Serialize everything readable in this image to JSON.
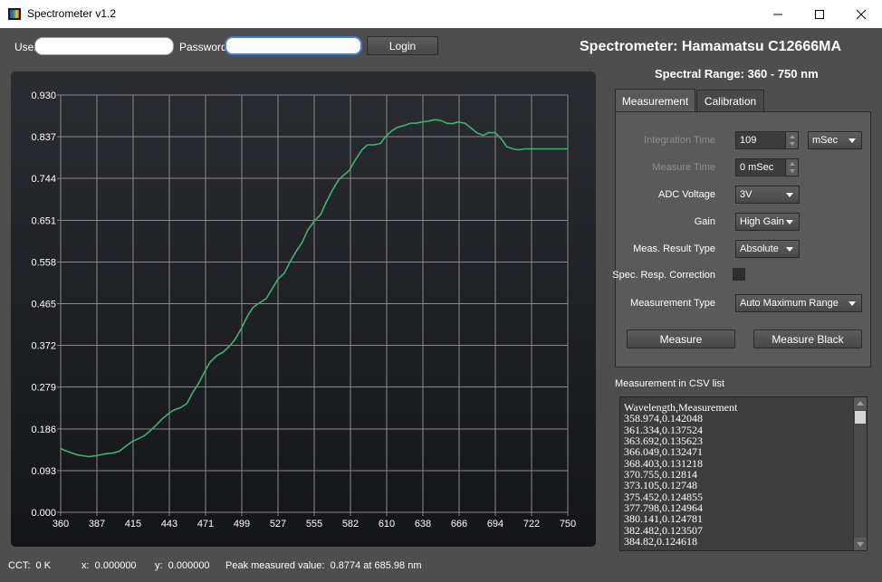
{
  "window": {
    "title": "Spectrometer v1.2"
  },
  "login": {
    "user_label": "User",
    "user_value": "",
    "password_label": "Password",
    "password_value": "",
    "login_button": "Login"
  },
  "header": {
    "title": "Spectrometer: Hamamatsu C12666MA",
    "range": "Spectral Range: 360 - 750 nm"
  },
  "tabs": [
    {
      "label": "Measurement",
      "active": true
    },
    {
      "label": "Calibration",
      "active": false
    }
  ],
  "measurement": {
    "integration_time_label": "Integration Time",
    "integration_time_value": "109",
    "integration_unit": "mSec",
    "measure_time_label": "Measure Time",
    "measure_time_value": "0 mSec",
    "adc_voltage_label": "ADC Voltage",
    "adc_voltage_value": "3V",
    "gain_label": "Gain",
    "gain_value": "High Gain",
    "meas_result_type_label": "Meas. Result Type",
    "meas_result_type_value": "Absolute",
    "spec_resp_correction_label": "Spec. Resp. Correction",
    "spec_resp_correction_checked": false,
    "measurement_type_label": "Measurement Type",
    "measurement_type_value": "Auto Maximum Range",
    "measure_button": "Measure",
    "measure_black_button": "Measure Black"
  },
  "csv": {
    "title": "Measurement in CSV list",
    "lines": [
      "Wavelength,Measurement",
      "358.974,0.142048",
      "361.334,0.137524",
      "363.692,0.135623",
      "366.049,0.132471",
      "368.403,0.131218",
      "370.755,0.12814",
      "373.105,0.12748",
      "375.452,0.124855",
      "377.798,0.124964",
      "380.141,0.124781",
      "382.482,0.123507",
      "384.82,0.124618"
    ]
  },
  "status": {
    "cct": "CCT:  0 K",
    "x": "x:  0.000000",
    "y": "y:  0.000000",
    "peak": "Peak measured value:  0.8774 at 685.98 nm"
  },
  "colors": {
    "line": "#3cb371",
    "grid": "#8a8a8a",
    "axis_text": "#ffffff"
  },
  "chart_data": {
    "type": "line",
    "xlim": [
      360,
      750
    ],
    "ylim": [
      0.0,
      0.93
    ],
    "x_ticks": [
      "360",
      "387",
      "415",
      "443",
      "471",
      "499",
      "527",
      "555",
      "582",
      "610",
      "638",
      "666",
      "694",
      "722",
      "750"
    ],
    "y_ticks": [
      "0.000",
      "0.093",
      "0.186",
      "0.279",
      "0.372",
      "0.465",
      "0.558",
      "0.651",
      "0.744",
      "0.837",
      "0.930"
    ],
    "grid": true,
    "series": [
      {
        "x": [
          360,
          364,
          368,
          373,
          377,
          382,
          387,
          392,
          396,
          400,
          405,
          410,
          415,
          419,
          424,
          429,
          433,
          438,
          443,
          447,
          452,
          457,
          461,
          466,
          471,
          475,
          480,
          485,
          490,
          494,
          499,
          504,
          508,
          513,
          518,
          522,
          527,
          532,
          536,
          541,
          546,
          550,
          555,
          560,
          564,
          569,
          574,
          578,
          582,
          587,
          592,
          596,
          601,
          606,
          610,
          615,
          619,
          624,
          629,
          633,
          638,
          643,
          647,
          652,
          657,
          661,
          666,
          671,
          675,
          680,
          685,
          689,
          694,
          699,
          703,
          708,
          712,
          717,
          722,
          726,
          731,
          736,
          740,
          745,
          750
        ],
        "y": [
          0.142,
          0.137,
          0.133,
          0.128,
          0.126,
          0.124,
          0.126,
          0.129,
          0.131,
          0.132,
          0.136,
          0.147,
          0.158,
          0.163,
          0.17,
          0.182,
          0.193,
          0.208,
          0.22,
          0.228,
          0.233,
          0.242,
          0.264,
          0.287,
          0.315,
          0.335,
          0.349,
          0.357,
          0.371,
          0.385,
          0.41,
          0.439,
          0.457,
          0.467,
          0.476,
          0.495,
          0.519,
          0.533,
          0.556,
          0.581,
          0.603,
          0.629,
          0.649,
          0.664,
          0.69,
          0.718,
          0.742,
          0.752,
          0.762,
          0.787,
          0.809,
          0.819,
          0.819,
          0.822,
          0.838,
          0.851,
          0.858,
          0.862,
          0.867,
          0.867,
          0.87,
          0.872,
          0.875,
          0.874,
          0.867,
          0.866,
          0.87,
          0.867,
          0.858,
          0.846,
          0.84,
          0.846,
          0.846,
          0.832,
          0.815,
          0.81,
          0.808,
          0.81,
          0.81,
          0.81,
          0.81,
          0.81,
          0.81,
          0.81,
          0.81
        ]
      }
    ]
  }
}
